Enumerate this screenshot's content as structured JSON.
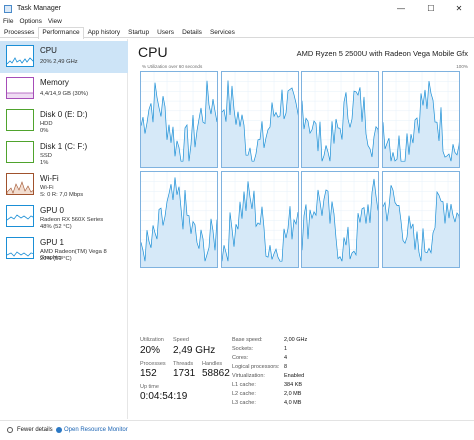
{
  "window": {
    "title": "Task Manager",
    "controls": [
      "—",
      "☐",
      "✕"
    ]
  },
  "menu": [
    "File",
    "Options",
    "View"
  ],
  "tabs": [
    "Processes",
    "Performance",
    "App history",
    "Startup",
    "Users",
    "Details",
    "Services"
  ],
  "active_tab": "Performance",
  "sidebar": [
    {
      "name": "CPU",
      "lines": [
        "20% 2,49 GHz"
      ],
      "color": "#1b8fd6"
    },
    {
      "name": "Memory",
      "lines": [
        "4,4/14,9 GB (30%)"
      ],
      "color": "#a64db8"
    },
    {
      "name": "Disk 0 (E: D:)",
      "lines": [
        "HDD",
        "0%"
      ],
      "color": "#4fa32d"
    },
    {
      "name": "Disk 1 (C: F:)",
      "lines": [
        "SSD",
        "1%"
      ],
      "color": "#4fa32d"
    },
    {
      "name": "Wi-Fi",
      "lines": [
        "Wi-Fi",
        "S: 0 R: 7,0 Mbps"
      ],
      "color": "#a0522d"
    },
    {
      "name": "GPU 0",
      "lines": [
        "Radeon RX 560X Series",
        "48% (52 °C)"
      ],
      "color": "#1b8fd6"
    },
    {
      "name": "GPU 1",
      "lines": [
        "AMD Radeon(TM) Vega 8 Graphics",
        "20% (51 °C)"
      ],
      "color": "#1b8fd6"
    }
  ],
  "main": {
    "title": "CPU",
    "model": "AMD Ryzen 5 2500U with Radeon Vega Mobile Gfx",
    "graph_label": "% Utilization over 60 seconds",
    "graph_max": "100%",
    "stats": {
      "utilization": {
        "label": "Utilization",
        "value": "20%"
      },
      "speed": {
        "label": "Speed",
        "value": "2,49 GHz"
      },
      "processes": {
        "label": "Processes",
        "value": "152"
      },
      "threads": {
        "label": "Threads",
        "value": "1731"
      },
      "handles": {
        "label": "Handles",
        "value": "58862"
      },
      "uptime": {
        "label": "Up time",
        "value": "0:04:54:19"
      }
    },
    "details": [
      {
        "label": "Base speed:",
        "value": "2,00 GHz"
      },
      {
        "label": "Sockets:",
        "value": "1"
      },
      {
        "label": "Cores:",
        "value": "4"
      },
      {
        "label": "Logical processors:",
        "value": "8"
      },
      {
        "label": "Virtualization:",
        "value": "Enabled"
      },
      {
        "label": "L1 cache:",
        "value": "384 KB"
      },
      {
        "label": "L2 cache:",
        "value": "2,0 MB"
      },
      {
        "label": "L3 cache:",
        "value": "4,0 MB"
      }
    ]
  },
  "footer": {
    "fewer": "Fewer details",
    "monitor": "Open Resource Monitor"
  },
  "colors": {
    "graph_line": "#1b8fd6",
    "graph_fill": "#d6e9f8",
    "graph_border": "#7fb2df",
    "selected": "#cde4f7"
  }
}
